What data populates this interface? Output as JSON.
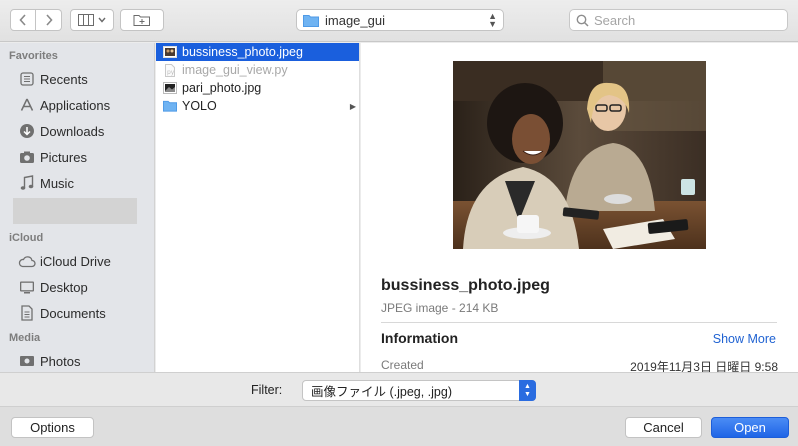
{
  "toolbar": {
    "location": "image_gui",
    "search_placeholder": "Search"
  },
  "sidebar": {
    "sections": [
      {
        "title": "Favorites",
        "items": [
          {
            "label": "Recents",
            "icon": "clock-icon"
          },
          {
            "label": "Applications",
            "icon": "applications-icon"
          },
          {
            "label": "Downloads",
            "icon": "download-icon"
          },
          {
            "label": "Pictures",
            "icon": "camera-icon"
          },
          {
            "label": "Music",
            "icon": "music-note-icon"
          }
        ]
      },
      {
        "title": "iCloud",
        "items": [
          {
            "label": "iCloud Drive",
            "icon": "cloud-icon"
          },
          {
            "label": "Desktop",
            "icon": "desktop-icon"
          },
          {
            "label": "Documents",
            "icon": "document-icon"
          }
        ]
      },
      {
        "title": "Media",
        "items": [
          {
            "label": "Photos",
            "icon": "photos-icon"
          }
        ]
      }
    ]
  },
  "files": [
    {
      "name": "bussiness_photo.jpeg",
      "type": "image",
      "selected": true,
      "enabled": true
    },
    {
      "name": "image_gui_view.py",
      "type": "script",
      "selected": false,
      "enabled": false
    },
    {
      "name": "pari_photo.jpg",
      "type": "image",
      "selected": false,
      "enabled": true
    },
    {
      "name": "YOLO",
      "type": "folder",
      "selected": false,
      "enabled": true
    }
  ],
  "preview": {
    "title": "bussiness_photo.jpeg",
    "subtitle": "JPEG image - 214 KB",
    "info_heading": "Information",
    "show_more": "Show More",
    "created_label": "Created",
    "created_value": "2019年11月3日 日曜日 9:58"
  },
  "filter": {
    "label": "Filter:",
    "selected": "画像ファイル (.jpeg, .jpg)"
  },
  "buttons": {
    "options": "Options",
    "cancel": "Cancel",
    "open": "Open"
  },
  "colors": {
    "accent": "#1a5fdd",
    "sidebar_bg": "#e3e5e9",
    "link": "#1f62d2"
  }
}
